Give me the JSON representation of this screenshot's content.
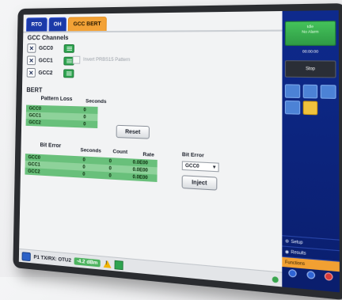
{
  "tabs": [
    "RTO",
    "OH",
    "GCC BERT"
  ],
  "gcc_channels": {
    "heading": "GCC Channels",
    "channels": [
      "GCC0",
      "GCC1",
      "GCC2"
    ],
    "invert_label": "Invert PRBS15 Pattern"
  },
  "bert": {
    "heading": "BERT",
    "pattern_loss": {
      "header": "Pattern Loss",
      "seconds_header": "Seconds",
      "rows": [
        {
          "name": "GCC0",
          "seconds": "0"
        },
        {
          "name": "GCC1",
          "seconds": "0"
        },
        {
          "name": "GCC2",
          "seconds": "0"
        }
      ]
    },
    "reset_label": "Reset",
    "bit_error": {
      "header": "Bit Error",
      "seconds_header": "Seconds",
      "count_header": "Count",
      "rate_header": "Rate",
      "rows": [
        {
          "name": "GCC0",
          "seconds": "0",
          "count": "0",
          "rate": "0.0E00"
        },
        {
          "name": "GCC1",
          "seconds": "0",
          "count": "0",
          "rate": "0.0E00"
        },
        {
          "name": "GCC2",
          "seconds": "0",
          "count": "0",
          "rate": "0.0E00"
        }
      ]
    },
    "bit_error_select_label": "Bit Error",
    "bit_error_select_value": "GCC0",
    "inject_label": "Inject"
  },
  "status_bar": {
    "port": "P1 TX/RX: OTU2",
    "power": "-4.2 dBm"
  },
  "side_panel": {
    "status_line1": "Idle",
    "status_line2": "No Alarm",
    "time": "00:00:00",
    "stop_label": "Stop",
    "menu": [
      "Setup",
      "Results",
      "Functions"
    ]
  }
}
